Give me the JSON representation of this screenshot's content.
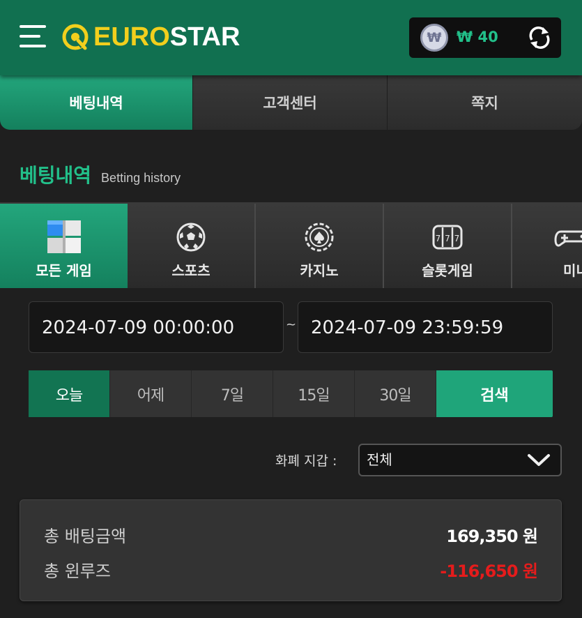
{
  "header": {
    "logo_euro": "EURO",
    "logo_star": "STAR",
    "coin_symbol": "₩",
    "balance": "₩ 40",
    "icons": [
      "menu-icon",
      "logo-mark-icon",
      "won-coin-icon",
      "refresh-icon"
    ]
  },
  "top_tabs": [
    {
      "label": "베팅내역",
      "active": true
    },
    {
      "label": "고객센터",
      "active": false
    },
    {
      "label": "쪽지",
      "active": false
    }
  ],
  "section": {
    "title": "베팅내역",
    "subtitle": "Betting history"
  },
  "categories": [
    {
      "label": "모든 게임",
      "icon": "all-games-icon",
      "active": true
    },
    {
      "label": "스포츠",
      "icon": "soccer-ball-icon",
      "active": false
    },
    {
      "label": "카지노",
      "icon": "casino-chip-icon",
      "active": false
    },
    {
      "label": "슬롯게임",
      "icon": "slot-machine-icon",
      "active": false
    },
    {
      "label": "미니",
      "icon": "gamepad-icon",
      "active": false
    }
  ],
  "date_range": {
    "from": "2024-07-09 00:00:00",
    "separator": "~",
    "to": "2024-07-09 23:59:59"
  },
  "periods": [
    {
      "label": "오늘",
      "active": true
    },
    {
      "label": "어제",
      "active": false
    },
    {
      "label": "7일",
      "active": false
    },
    {
      "label": "15일",
      "active": false
    },
    {
      "label": "30일",
      "active": false
    }
  ],
  "search_label": "검색",
  "wallet_filter": {
    "label": "화폐 지갑 :",
    "selected": "전체"
  },
  "summary": {
    "bet_label": "총 배팅금액",
    "bet_value": "169,350 원",
    "winlose_label": "총 윈루즈",
    "winlose_value": "-116,650 원"
  },
  "colors": {
    "header_green": "#117050",
    "active_green": "#1fa57a",
    "accent_text_green": "#22c08a",
    "logo_yellow": "#f2cf1d",
    "negative_red": "#e51c1c",
    "background": "#1f1f1f"
  }
}
